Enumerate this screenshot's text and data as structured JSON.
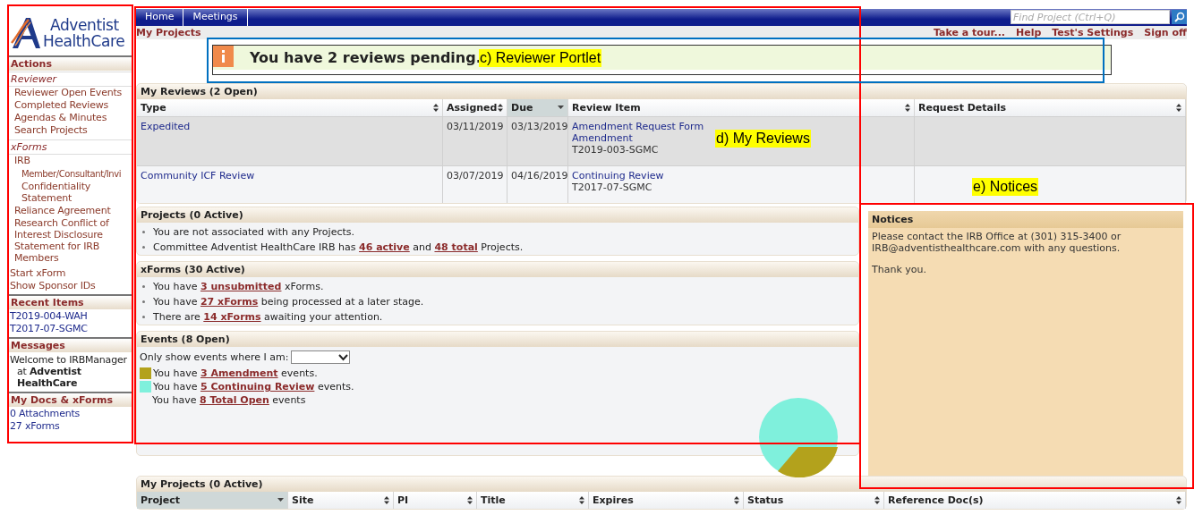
{
  "logo": {
    "line_1": "Adventist",
    "line_2": "HealthCare"
  },
  "sidebar": {
    "sections": [
      {
        "title": "Actions",
        "groups": [
          {
            "heading": "Reviewer",
            "items": [
              {
                "label": "Reviewer Open Events"
              },
              {
                "label": "Completed Reviews"
              },
              {
                "label": "Agendas & Minutes"
              },
              {
                "label": "Search Projects"
              }
            ]
          },
          {
            "heading": "xForms",
            "items": [
              {
                "label": "IRB",
                "children": [
                  {
                    "label": "Member/Consultant/Invi Confidentiality Statement"
                  }
                ]
              },
              {
                "label": "Reliance Agreement"
              },
              {
                "label": "Research Conflict of Interest Disclosure Statement for IRB Members"
              }
            ]
          }
        ],
        "links": [
          {
            "label": "Start xForm"
          },
          {
            "label": "Show Sponsor IDs"
          }
        ]
      },
      {
        "title": "Recent Items",
        "links": [
          {
            "label": "T2019-004-WAH"
          },
          {
            "label": "T2017-07-SGMC"
          }
        ]
      },
      {
        "title": "Messages",
        "message": "Welcome to IRBManager at **Adventist HealthCare**"
      },
      {
        "title": "My Docs & xForms",
        "links": [
          {
            "label": "0 Attachments"
          },
          {
            "label": "27 xForms"
          }
        ]
      }
    ]
  },
  "nav": {
    "tabs": [
      {
        "label": "Home",
        "selected": false
      },
      {
        "label": "Meetings",
        "selected": false
      }
    ],
    "search": {
      "placeholder": "Find Project (Ctrl+Q)"
    }
  },
  "subbar": {
    "title": "My Projects",
    "links": [
      "Take a tour...",
      "Help",
      "Test's Settings",
      "Sign off"
    ]
  },
  "alert": {
    "message": "You have 2 reviews pending."
  },
  "my_reviews": {
    "title": "My Reviews (2 Open)",
    "columns": [
      {
        "label": "Type",
        "sorted": false
      },
      {
        "label": "Assigned",
        "sorted": false
      },
      {
        "label": "Due",
        "sorted": true
      },
      {
        "label": "Review Item",
        "sorted": false
      },
      {
        "label": "Request Details",
        "sorted": false
      }
    ],
    "rows": [
      {
        "selected": true,
        "type": "Expedited",
        "assigned": "03/11/2019",
        "due": "03/13/2019",
        "item_link": "Amendment Request Form Amendment",
        "item_id": "T2019-003-SGMC"
      },
      {
        "selected": false,
        "type": "Community ICF Review",
        "assigned": "03/07/2019",
        "due": "04/16/2019",
        "item_link": "Continuing Review",
        "item_id": "T2017-07-SGMC"
      }
    ]
  },
  "projects": {
    "title": "Projects (0 Active)",
    "items": [
      [
        {
          "kind": "text",
          "text": "You are not associated with any Projects."
        }
      ],
      [
        {
          "kind": "text",
          "text": "Committee Adventist HealthCare IRB has "
        },
        {
          "kind": "link",
          "text": "46 active"
        },
        {
          "kind": "text",
          "text": " and "
        },
        {
          "kind": "link",
          "text": "48 total"
        },
        {
          "kind": "text",
          "text": " Projects."
        }
      ]
    ]
  },
  "xforms": {
    "title": "xForms (30 Active)",
    "items": [
      [
        {
          "kind": "text",
          "text": "You have "
        },
        {
          "kind": "link",
          "text": "3 unsubmitted"
        },
        {
          "kind": "text",
          "text": " xForms."
        }
      ],
      [
        {
          "kind": "text",
          "text": "You have "
        },
        {
          "kind": "link",
          "text": "27 xForms"
        },
        {
          "kind": "text",
          "text": " being processed at a later stage."
        }
      ],
      [
        {
          "kind": "text",
          "text": "There are "
        },
        {
          "kind": "link",
          "text": "14 xForms"
        },
        {
          "kind": "text",
          "text": " awaiting your attention."
        }
      ]
    ]
  },
  "events": {
    "title": "Events (8 Open)",
    "filter_label": "Only show events where I am:",
    "lines": [
      {
        "color": "#b3a21c",
        "parts": [
          {
            "kind": "text",
            "text": "You have "
          },
          {
            "kind": "link",
            "text": "3 Amendment"
          },
          {
            "kind": "text",
            "text": " events."
          }
        ]
      },
      {
        "color": "#7ff0dc",
        "parts": [
          {
            "kind": "text",
            "text": "You have "
          },
          {
            "kind": "link",
            "text": "5 Continuing Review"
          },
          {
            "kind": "text",
            "text": " events."
          }
        ]
      },
      {
        "parts": [
          {
            "kind": "text",
            "text": "You have "
          },
          {
            "kind": "link",
            "text": "8 Total Open"
          },
          {
            "kind": "text",
            "text": " events"
          }
        ]
      }
    ]
  },
  "notices": {
    "title": "Notices",
    "paragraphs": [
      "Please contact the IRB Office at (301) 315-3400 or IRB@adventisthealthcare.com with any questions.",
      "Thank you."
    ]
  },
  "my_projects": {
    "title": "My Projects (0 Active)",
    "columns": [
      {
        "label": "Project",
        "sorted": true
      },
      {
        "label": "Site",
        "sorted": false
      },
      {
        "label": "PI",
        "sorted": false
      },
      {
        "label": "Title",
        "sorted": false
      },
      {
        "label": "Expires",
        "sorted": false
      },
      {
        "label": "Status",
        "sorted": false
      },
      {
        "label": "Reference Doc(s)",
        "sorted": false
      }
    ]
  },
  "annotations": {
    "frames": [
      {
        "color": "#ff0000"
      },
      {
        "color": "#ff0000"
      },
      {
        "color": "#0070c0"
      },
      {
        "color": "#ff0000"
      }
    ],
    "labels": [
      "c) Reviewer Portlet",
      "d) My Reviews",
      "e) Notices"
    ]
  }
}
